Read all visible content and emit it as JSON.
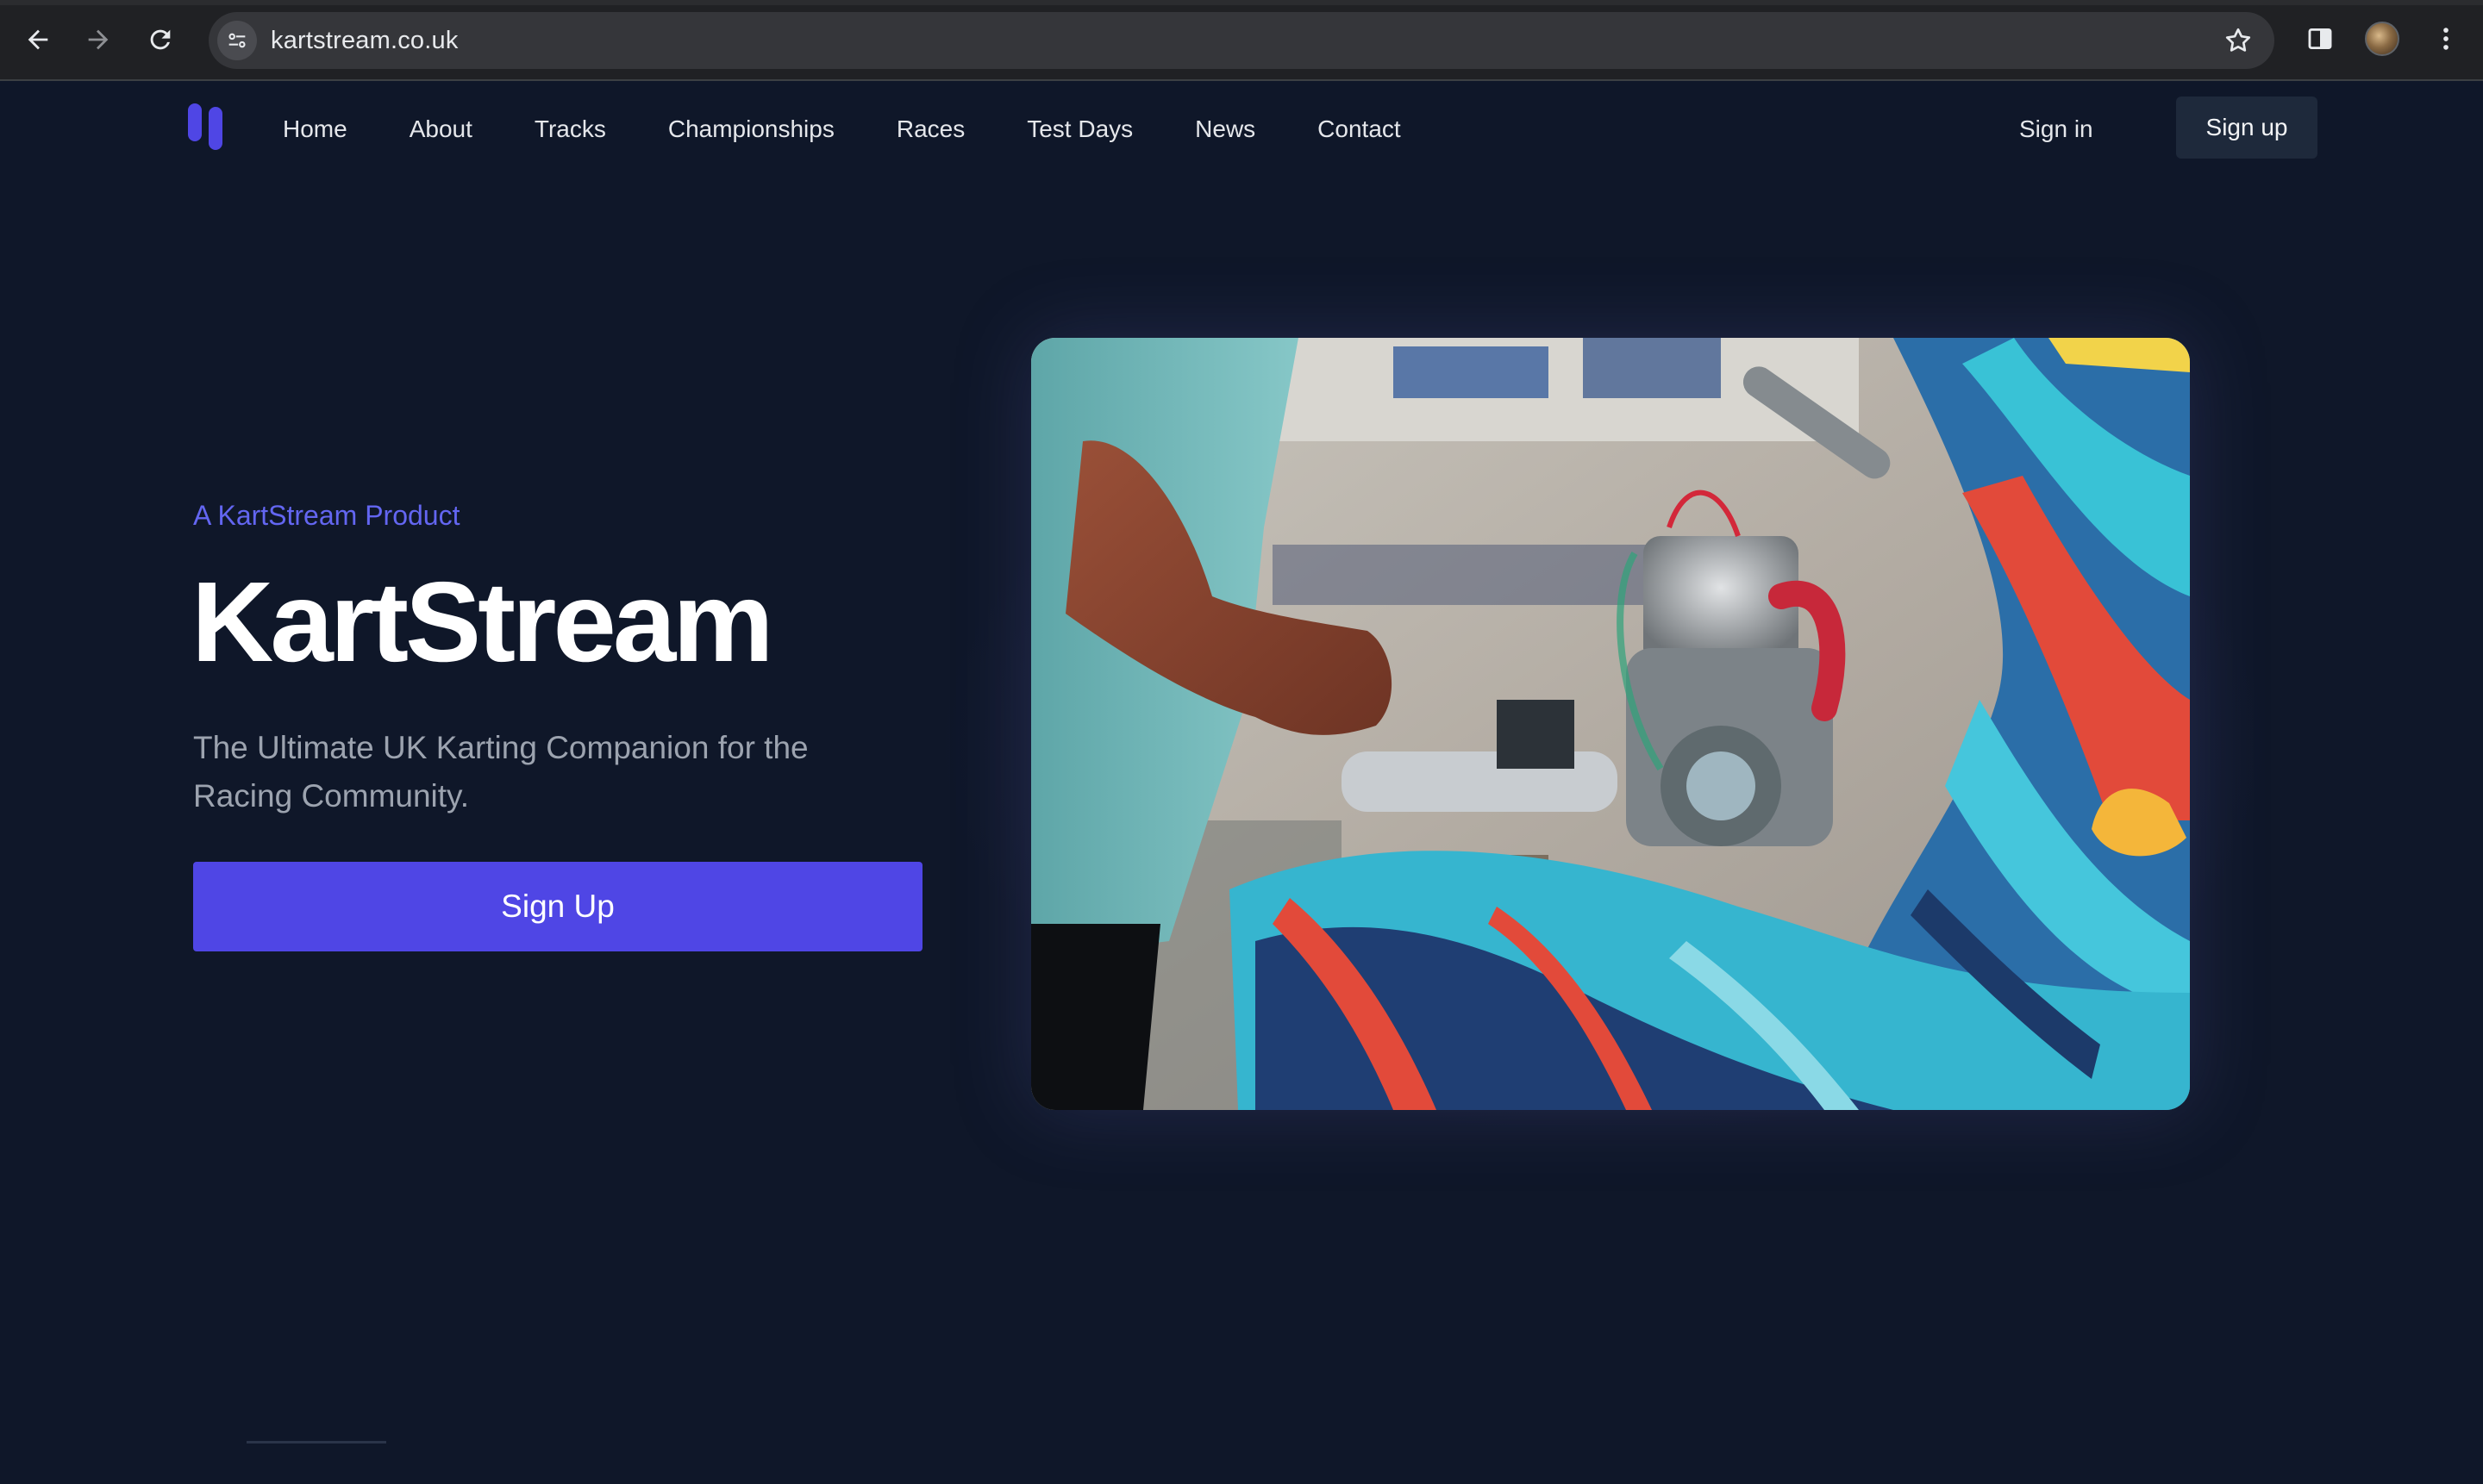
{
  "browser": {
    "url": "kartstream.co.uk",
    "icons": {
      "back": "arrow-left-icon",
      "forward": "arrow-right-icon",
      "reload": "reload-icon",
      "site_info": "tune-icon",
      "bookmark": "star-icon",
      "side_panel": "side-panel-icon",
      "profile": "avatar",
      "menu": "more-vertical-icon"
    }
  },
  "header": {
    "nav": [
      {
        "label": "Home"
      },
      {
        "label": "About"
      },
      {
        "label": "Tracks"
      },
      {
        "label": "Championships"
      },
      {
        "label": "Races"
      },
      {
        "label": "Test Days"
      },
      {
        "label": "News"
      },
      {
        "label": "Contact"
      }
    ],
    "sign_in": "Sign in",
    "sign_up": "Sign up"
  },
  "hero": {
    "eyebrow": "A KartStream Product",
    "title": "KartStream",
    "subtitle": "The Ultimate UK Karting Companion for the Racing Community.",
    "cta": "Sign Up",
    "image_subject": "go-kart-engine-photo"
  },
  "colors": {
    "background": "#0f1729",
    "accent": "#4f46e5",
    "eyebrow": "#6366f1",
    "subtitle": "#9ca3af",
    "secondary_button": "#1e293b"
  }
}
